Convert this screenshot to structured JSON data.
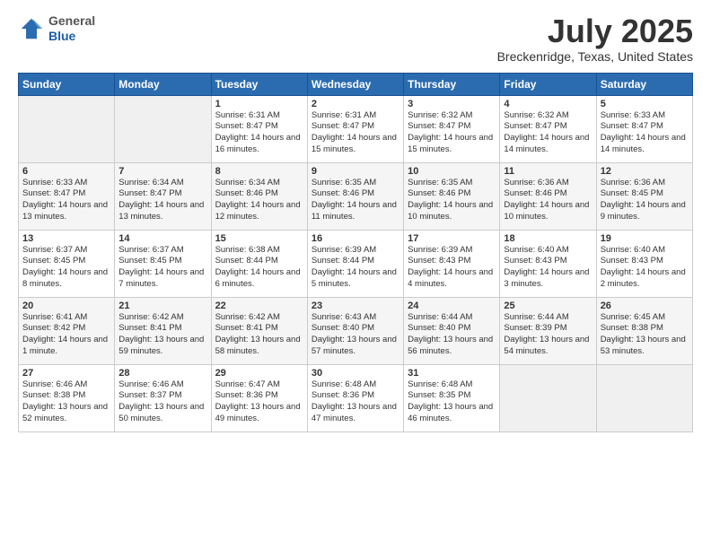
{
  "header": {
    "logo_general": "General",
    "logo_blue": "Blue",
    "month_title": "July 2025",
    "subtitle": "Breckenridge, Texas, United States"
  },
  "days_of_week": [
    "Sunday",
    "Monday",
    "Tuesday",
    "Wednesday",
    "Thursday",
    "Friday",
    "Saturday"
  ],
  "weeks": [
    [
      {
        "day": "",
        "content": ""
      },
      {
        "day": "",
        "content": ""
      },
      {
        "day": "1",
        "content": "Sunrise: 6:31 AM\nSunset: 8:47 PM\nDaylight: 14 hours and 16 minutes."
      },
      {
        "day": "2",
        "content": "Sunrise: 6:31 AM\nSunset: 8:47 PM\nDaylight: 14 hours and 15 minutes."
      },
      {
        "day": "3",
        "content": "Sunrise: 6:32 AM\nSunset: 8:47 PM\nDaylight: 14 hours and 15 minutes."
      },
      {
        "day": "4",
        "content": "Sunrise: 6:32 AM\nSunset: 8:47 PM\nDaylight: 14 hours and 14 minutes."
      },
      {
        "day": "5",
        "content": "Sunrise: 6:33 AM\nSunset: 8:47 PM\nDaylight: 14 hours and 14 minutes."
      }
    ],
    [
      {
        "day": "6",
        "content": "Sunrise: 6:33 AM\nSunset: 8:47 PM\nDaylight: 14 hours and 13 minutes."
      },
      {
        "day": "7",
        "content": "Sunrise: 6:34 AM\nSunset: 8:47 PM\nDaylight: 14 hours and 13 minutes."
      },
      {
        "day": "8",
        "content": "Sunrise: 6:34 AM\nSunset: 8:46 PM\nDaylight: 14 hours and 12 minutes."
      },
      {
        "day": "9",
        "content": "Sunrise: 6:35 AM\nSunset: 8:46 PM\nDaylight: 14 hours and 11 minutes."
      },
      {
        "day": "10",
        "content": "Sunrise: 6:35 AM\nSunset: 8:46 PM\nDaylight: 14 hours and 10 minutes."
      },
      {
        "day": "11",
        "content": "Sunrise: 6:36 AM\nSunset: 8:46 PM\nDaylight: 14 hours and 10 minutes."
      },
      {
        "day": "12",
        "content": "Sunrise: 6:36 AM\nSunset: 8:45 PM\nDaylight: 14 hours and 9 minutes."
      }
    ],
    [
      {
        "day": "13",
        "content": "Sunrise: 6:37 AM\nSunset: 8:45 PM\nDaylight: 14 hours and 8 minutes."
      },
      {
        "day": "14",
        "content": "Sunrise: 6:37 AM\nSunset: 8:45 PM\nDaylight: 14 hours and 7 minutes."
      },
      {
        "day": "15",
        "content": "Sunrise: 6:38 AM\nSunset: 8:44 PM\nDaylight: 14 hours and 6 minutes."
      },
      {
        "day": "16",
        "content": "Sunrise: 6:39 AM\nSunset: 8:44 PM\nDaylight: 14 hours and 5 minutes."
      },
      {
        "day": "17",
        "content": "Sunrise: 6:39 AM\nSunset: 8:43 PM\nDaylight: 14 hours and 4 minutes."
      },
      {
        "day": "18",
        "content": "Sunrise: 6:40 AM\nSunset: 8:43 PM\nDaylight: 14 hours and 3 minutes."
      },
      {
        "day": "19",
        "content": "Sunrise: 6:40 AM\nSunset: 8:43 PM\nDaylight: 14 hours and 2 minutes."
      }
    ],
    [
      {
        "day": "20",
        "content": "Sunrise: 6:41 AM\nSunset: 8:42 PM\nDaylight: 14 hours and 1 minute."
      },
      {
        "day": "21",
        "content": "Sunrise: 6:42 AM\nSunset: 8:41 PM\nDaylight: 13 hours and 59 minutes."
      },
      {
        "day": "22",
        "content": "Sunrise: 6:42 AM\nSunset: 8:41 PM\nDaylight: 13 hours and 58 minutes."
      },
      {
        "day": "23",
        "content": "Sunrise: 6:43 AM\nSunset: 8:40 PM\nDaylight: 13 hours and 57 minutes."
      },
      {
        "day": "24",
        "content": "Sunrise: 6:44 AM\nSunset: 8:40 PM\nDaylight: 13 hours and 56 minutes."
      },
      {
        "day": "25",
        "content": "Sunrise: 6:44 AM\nSunset: 8:39 PM\nDaylight: 13 hours and 54 minutes."
      },
      {
        "day": "26",
        "content": "Sunrise: 6:45 AM\nSunset: 8:38 PM\nDaylight: 13 hours and 53 minutes."
      }
    ],
    [
      {
        "day": "27",
        "content": "Sunrise: 6:46 AM\nSunset: 8:38 PM\nDaylight: 13 hours and 52 minutes."
      },
      {
        "day": "28",
        "content": "Sunrise: 6:46 AM\nSunset: 8:37 PM\nDaylight: 13 hours and 50 minutes."
      },
      {
        "day": "29",
        "content": "Sunrise: 6:47 AM\nSunset: 8:36 PM\nDaylight: 13 hours and 49 minutes."
      },
      {
        "day": "30",
        "content": "Sunrise: 6:48 AM\nSunset: 8:36 PM\nDaylight: 13 hours and 47 minutes."
      },
      {
        "day": "31",
        "content": "Sunrise: 6:48 AM\nSunset: 8:35 PM\nDaylight: 13 hours and 46 minutes."
      },
      {
        "day": "",
        "content": ""
      },
      {
        "day": "",
        "content": ""
      }
    ]
  ]
}
